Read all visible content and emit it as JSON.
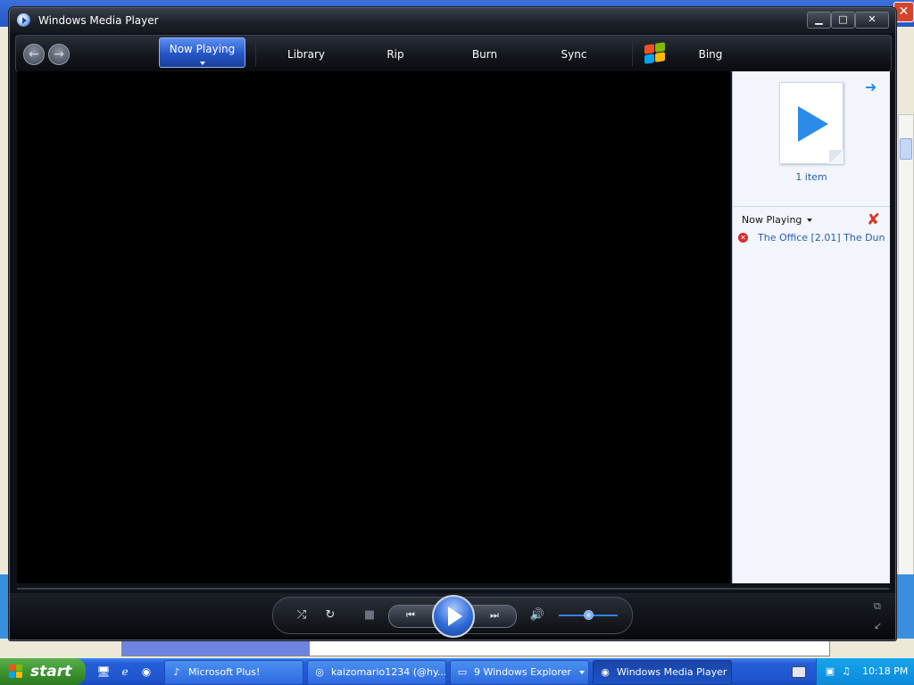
{
  "window": {
    "title": "Windows Media Player",
    "minimize_icon": "minimize-icon",
    "maximize_icon": "maximize-icon",
    "close_icon": "close-icon"
  },
  "nav": {
    "back_icon": "back-arrow-icon",
    "forward_icon": "forward-arrow-icon",
    "tabs": [
      {
        "label": "Now Playing",
        "active": true
      },
      {
        "label": "Library",
        "active": false
      },
      {
        "label": "Rip",
        "active": false
      },
      {
        "label": "Burn",
        "active": false
      },
      {
        "label": "Sync",
        "active": false
      },
      {
        "label": "Bing",
        "active": false
      }
    ]
  },
  "list_pane": {
    "item_count": "1 item",
    "list_title": "Now Playing",
    "items": [
      {
        "title": "The Office [2.01] The Dun...",
        "status": "error"
      }
    ]
  },
  "controls": {
    "shuffle_icon": "shuffle-icon",
    "repeat_icon": "repeat-icon",
    "stop_icon": "stop-icon",
    "previous_icon": "previous-icon",
    "play_icon": "play-icon",
    "next_icon": "next-icon",
    "mute_icon": "volume-icon",
    "volume_level": 0.5
  },
  "taskbar": {
    "start_label": "start",
    "buttons": [
      {
        "label": "Microsoft Plus!",
        "active": false
      },
      {
        "label": "kaizomario1234 (@hy...",
        "active": false
      },
      {
        "label": "9 Windows Explorer",
        "active": false
      },
      {
        "label": "Windows Media Player",
        "active": true
      }
    ],
    "clock": "10:18 PM"
  },
  "colors": {
    "accent": "#2456c6",
    "link": "#2a5db0",
    "error": "#d42d2d",
    "taskbar": "#245dd8",
    "start": "#3c912f"
  }
}
